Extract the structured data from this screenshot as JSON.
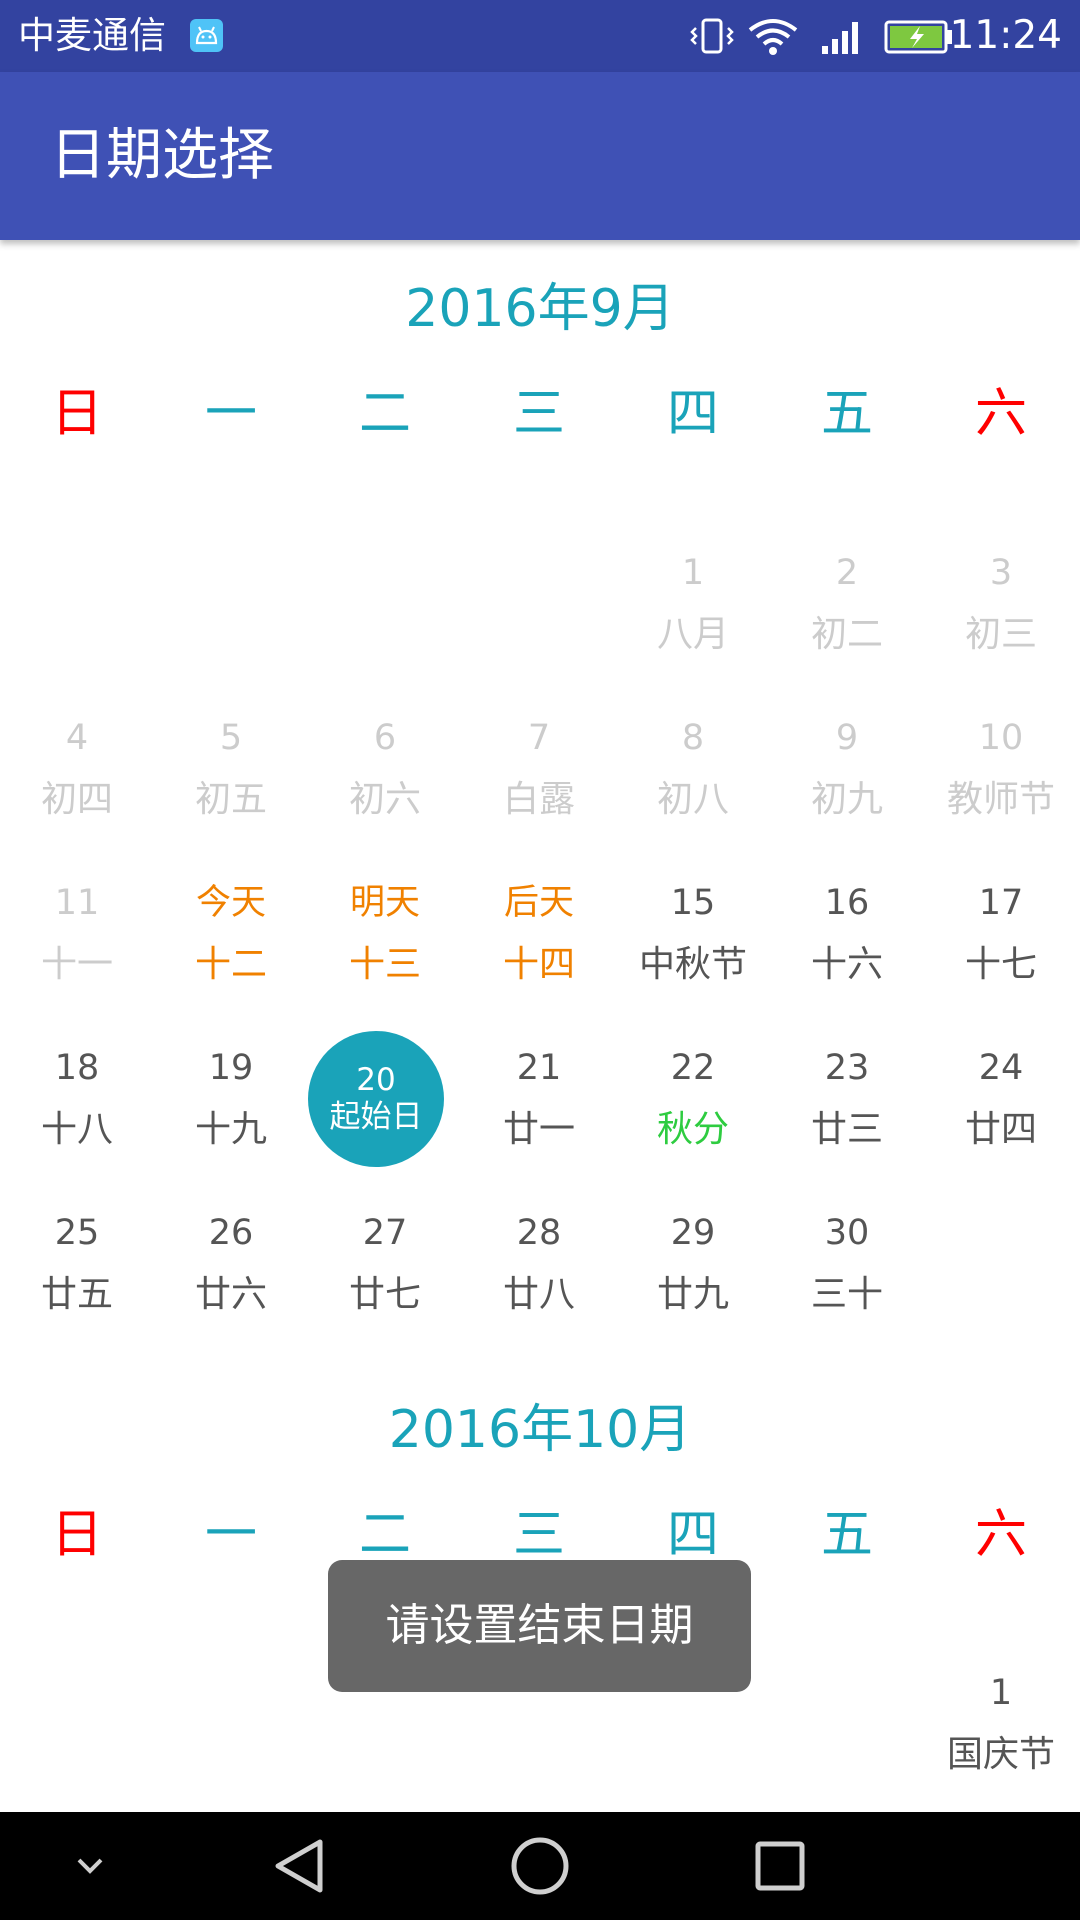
{
  "status_bar": {
    "carrier": "中麦通信",
    "time": "11:24",
    "battery_color": "#7ec840"
  },
  "app_bar": {
    "title": "日期选择"
  },
  "weekdays": [
    "日",
    "一",
    "二",
    "三",
    "四",
    "五",
    "六"
  ],
  "months": [
    {
      "title": "2016年9月",
      "days": [
        {
          "num": "1",
          "sub": "八月",
          "state": "past"
        },
        {
          "num": "2",
          "sub": "初二",
          "state": "past"
        },
        {
          "num": "3",
          "sub": "初三",
          "state": "past"
        },
        {
          "num": "4",
          "sub": "初四",
          "state": "past"
        },
        {
          "num": "5",
          "sub": "初五",
          "state": "past"
        },
        {
          "num": "6",
          "sub": "初六",
          "state": "past"
        },
        {
          "num": "7",
          "sub": "白露",
          "state": "past"
        },
        {
          "num": "8",
          "sub": "初八",
          "state": "past"
        },
        {
          "num": "9",
          "sub": "初九",
          "state": "past"
        },
        {
          "num": "10",
          "sub": "教师节",
          "state": "past"
        },
        {
          "num": "11",
          "sub": "十一",
          "state": "past"
        },
        {
          "num": "今天",
          "sub": "十二",
          "state": "special"
        },
        {
          "num": "明天",
          "sub": "十三",
          "state": "special"
        },
        {
          "num": "后天",
          "sub": "十四",
          "state": "special"
        },
        {
          "num": "15",
          "sub": "中秋节",
          "state": "normal"
        },
        {
          "num": "16",
          "sub": "十六",
          "state": "normal"
        },
        {
          "num": "17",
          "sub": "十七",
          "state": "normal"
        },
        {
          "num": "18",
          "sub": "十八",
          "state": "normal"
        },
        {
          "num": "19",
          "sub": "十九",
          "state": "normal"
        },
        {
          "num": "20",
          "sub": "起始日",
          "state": "selected"
        },
        {
          "num": "21",
          "sub": "廿一",
          "state": "normal"
        },
        {
          "num": "22",
          "sub": "秋分",
          "state": "term"
        },
        {
          "num": "23",
          "sub": "廿三",
          "state": "normal"
        },
        {
          "num": "24",
          "sub": "廿四",
          "state": "normal"
        },
        {
          "num": "25",
          "sub": "廿五",
          "state": "normal"
        },
        {
          "num": "26",
          "sub": "廿六",
          "state": "normal"
        },
        {
          "num": "27",
          "sub": "廿七",
          "state": "normal"
        },
        {
          "num": "28",
          "sub": "廿八",
          "state": "normal"
        },
        {
          "num": "29",
          "sub": "廿九",
          "state": "normal"
        },
        {
          "num": "30",
          "sub": "三十",
          "state": "normal"
        }
      ]
    },
    {
      "title": "2016年10月",
      "days": [
        {
          "num": "1",
          "sub": "国庆节",
          "state": "normal"
        }
      ]
    }
  ],
  "toast": {
    "text": "请设置结束日期"
  },
  "nav_bar": {
    "icons": [
      "chevron-down-icon",
      "back-icon",
      "home-icon",
      "recents-icon"
    ]
  }
}
